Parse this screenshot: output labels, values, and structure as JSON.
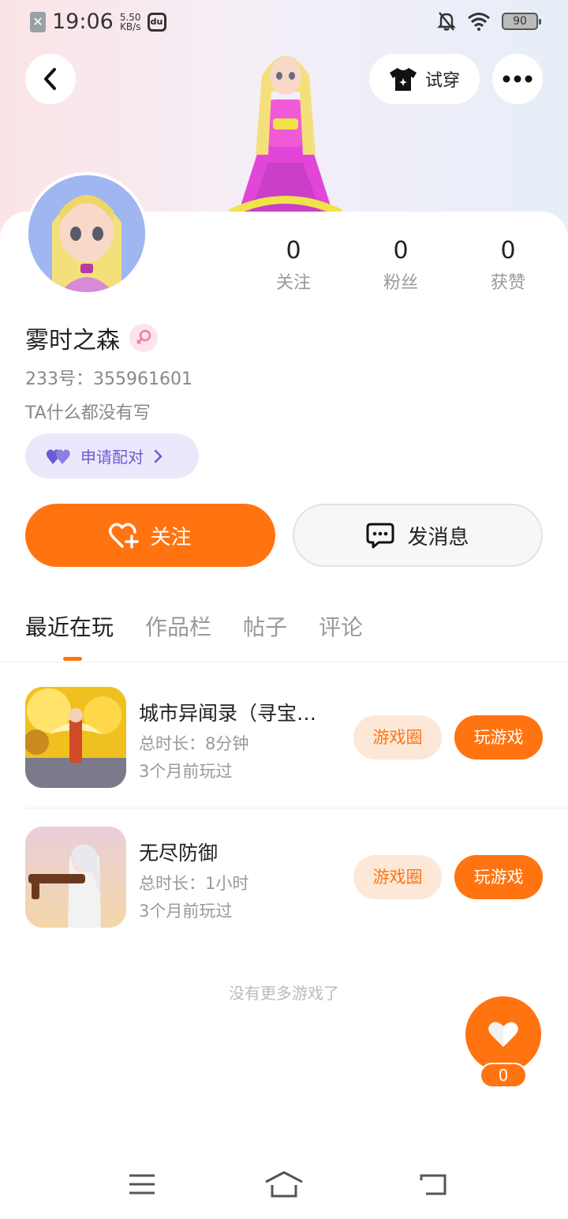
{
  "status_bar": {
    "time": "19:06",
    "net_speed_value": "5.50",
    "net_speed_unit": "KB/s",
    "battery": "90"
  },
  "header": {
    "try_on_label": "试穿"
  },
  "profile": {
    "name": "雾时之森",
    "uid": "233号：355961601",
    "bio": "TA什么都没有写",
    "pair_label": "申请配对",
    "stats": [
      {
        "value": "0",
        "label": "关注"
      },
      {
        "value": "0",
        "label": "粉丝"
      },
      {
        "value": "0",
        "label": "获赞"
      }
    ]
  },
  "actions": {
    "follow_label": "关注",
    "message_label": "发消息"
  },
  "tabs": [
    {
      "label": "最近在玩",
      "active": true
    },
    {
      "label": "作品栏",
      "active": false
    },
    {
      "label": "帖子",
      "active": false
    },
    {
      "label": "评论",
      "active": false
    }
  ],
  "games": [
    {
      "title": "城市异闻录（寻宝…",
      "duration": "总时长：8分钟",
      "last_played": "3个月前玩过",
      "circle_label": "游戏圈",
      "play_label": "玩游戏"
    },
    {
      "title": "无尽防御",
      "duration": "总时长：1小时",
      "last_played": "3个月前玩过",
      "circle_label": "游戏圈",
      "play_label": "玩游戏"
    }
  ],
  "list_footer": "没有更多游戏了",
  "like_fab": {
    "count": "0"
  },
  "colors": {
    "accent": "#ff7410",
    "accent_light": "#fde8d8",
    "pair_bg": "#ebe8fb",
    "pair_text": "#6a5cd6"
  }
}
